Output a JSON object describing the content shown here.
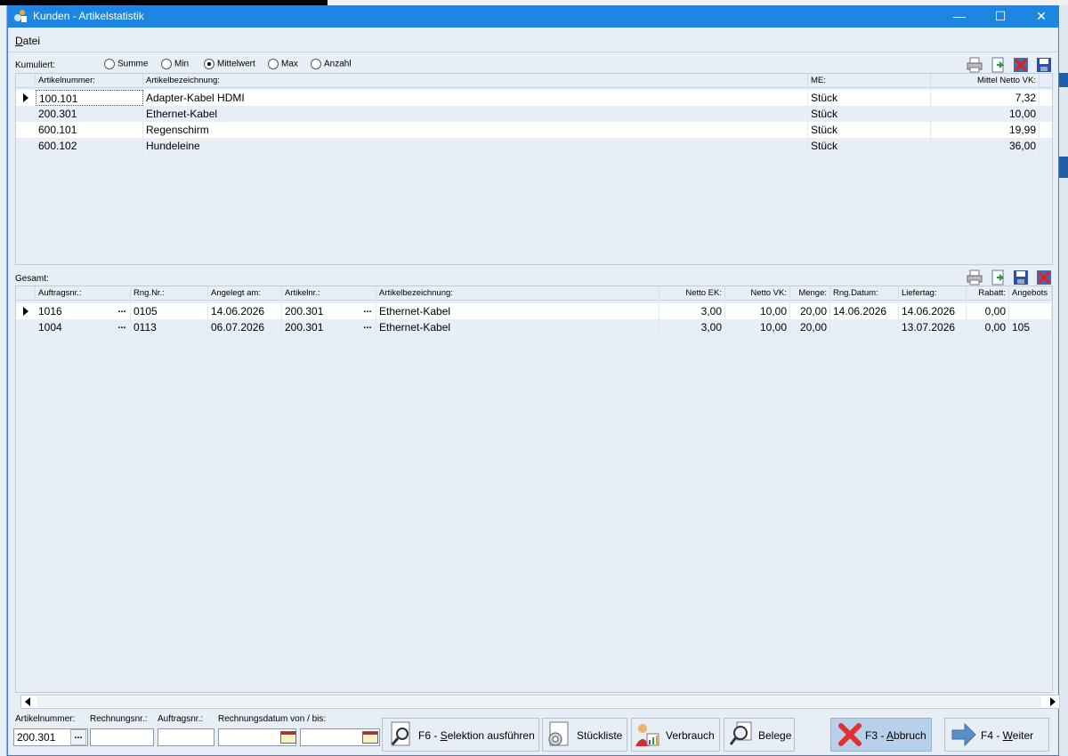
{
  "window": {
    "title": "Kunden - Artikelstatistik"
  },
  "menu": {
    "datei_pre": "",
    "datei_u": "D",
    "datei_rest": "atei"
  },
  "kumuliert": {
    "label": "Kumuliert:",
    "options": [
      {
        "label": "Summe",
        "selected": false
      },
      {
        "label": "Min",
        "selected": false
      },
      {
        "label": "Mittelwert",
        "selected": true
      },
      {
        "label": "Max",
        "selected": false
      },
      {
        "label": "Anzahl",
        "selected": false
      }
    ]
  },
  "top_grid": {
    "headers": [
      "Artikelnummer:",
      "Artikelbezeichnung:",
      "ME:",
      "Mittel Netto VK:"
    ],
    "rows": [
      [
        "100.101",
        "Adapter-Kabel HDMI",
        "Stück",
        "7,32"
      ],
      [
        "200.301",
        "Ethernet-Kabel",
        "Stück",
        "10,00"
      ],
      [
        "600.101",
        "Regenschirm",
        "Stück",
        "19,99"
      ],
      [
        "600.102",
        "Hundeleine",
        "Stück",
        "36,00"
      ]
    ]
  },
  "gesamt": {
    "label": "Gesamt:"
  },
  "bottom_grid": {
    "headers": [
      "Auftragsnr.:",
      "Rng.Nr.:",
      "Angelegt am:",
      "Artikelnr.:",
      "Artikelbezeichnung:",
      "Netto EK:",
      "Netto VK:",
      "Menge:",
      "Rng.Datum:",
      "Liefertag:",
      "Rabatt:",
      "Angebots"
    ],
    "rows": [
      [
        "1016",
        "0105",
        "14.06.2026",
        "200.301",
        "Ethernet-Kabel",
        "3,00",
        "10,00",
        "20,00",
        "14.06.2026",
        "14.06.2026",
        "0,00",
        ""
      ],
      [
        "1004",
        "0113",
        "06.07.2026",
        "200.301",
        "Ethernet-Kabel",
        "3,00",
        "10,00",
        "20,00",
        "",
        "13.07.2026",
        "0,00",
        "105"
      ]
    ]
  },
  "filters": {
    "artikelnummer_label": "Artikelnummer:",
    "artikelnummer_value": "200.301",
    "rechnungsnr_label": "Rechnungsnr.:",
    "rechnungsnr_value": "",
    "auftragsnr_label": "Auftragsnr.:",
    "auftragsnr_value": "",
    "datum_label": "Rechnungsdatum von / bis:",
    "datum_von": "",
    "datum_bis": ""
  },
  "buttons": {
    "selektion_pre": "F6 - ",
    "selektion_u": "S",
    "selektion_rest": "elektion ausführen",
    "stueckliste": "Stückliste",
    "verbrauch": "Verbrauch",
    "belege": "Belege",
    "abbruch_pre": "F3 - ",
    "abbruch_u": "A",
    "abbruch_rest": "bbruch",
    "weiter_pre": "F4 - ",
    "weiter_u": "W",
    "weiter_rest": "eiter"
  },
  "colors": {
    "titlebar": "#1d86e0",
    "window_bg": "#e8eef5",
    "highlight_button": "#b8d0ea"
  }
}
